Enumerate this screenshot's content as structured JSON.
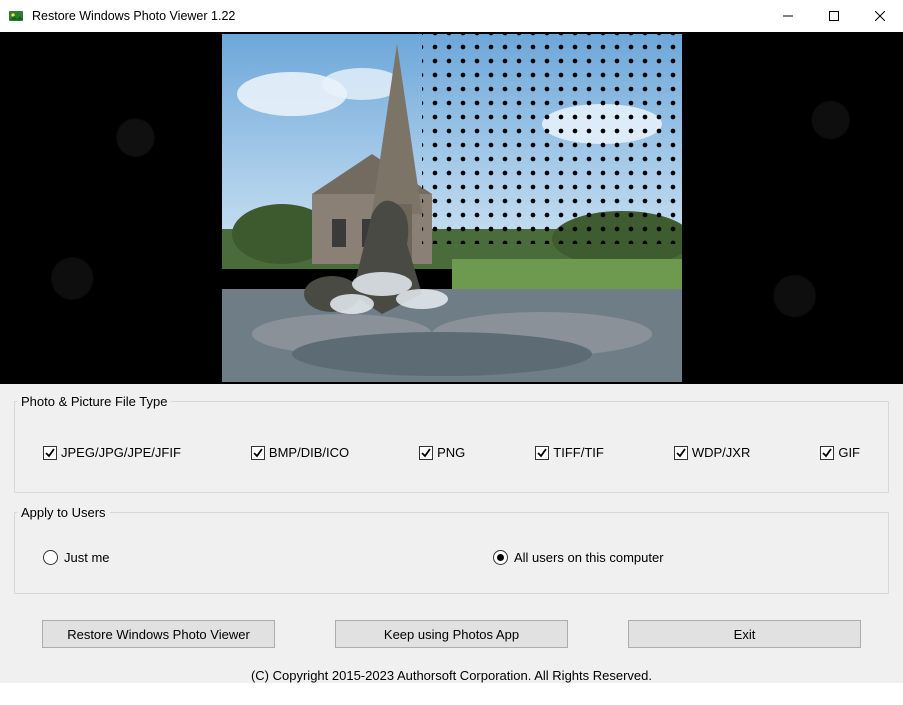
{
  "window": {
    "title": "Restore Windows Photo Viewer 1.22"
  },
  "groups": {
    "filetype_legend": "Photo & Picture File Type",
    "users_legend": "Apply to Users"
  },
  "filetypes": {
    "jpeg": "JPEG/JPG/JPE/JFIF",
    "bmp": "BMP/DIB/ICO",
    "png": "PNG",
    "tiff": "TIFF/TIF",
    "wdp": "WDP/JXR",
    "gif": "GIF"
  },
  "users": {
    "me": "Just me",
    "all": "All users on this computer"
  },
  "buttons": {
    "restore": "Restore Windows Photo Viewer",
    "keep": "Keep using Photos App",
    "exit": "Exit"
  },
  "footer": {
    "copyright": "(C) Copyright 2015-2023 Authorsoft Corporation. All Rights Reserved."
  }
}
